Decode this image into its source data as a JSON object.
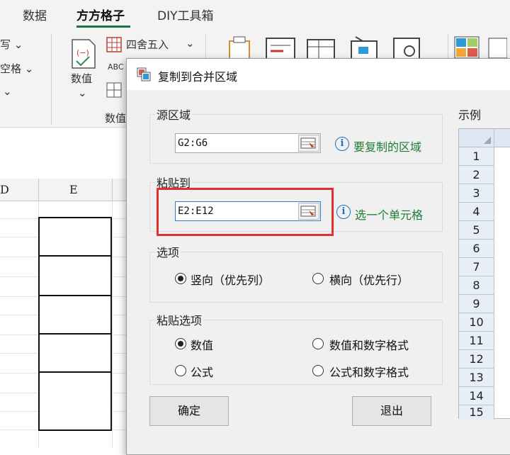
{
  "ribbon": {
    "tabs": [
      "数据",
      "方方格子",
      "DIY工具箱"
    ],
    "left_items": [
      "写",
      "空格",
      ""
    ],
    "numeric_label": "数值",
    "numeric_group_label": "数值",
    "round_label": "四舍五入",
    "abc_label": "ABC"
  },
  "sheet": {
    "col_d": "D",
    "col_e": "E"
  },
  "dialog": {
    "title": "复制到合并区域",
    "source": {
      "label": "源区域",
      "value": "G2:G6",
      "hint": "要复制的区域"
    },
    "paste_to": {
      "label": "粘贴到",
      "value": "E2:E12",
      "hint": "选一个单元格"
    },
    "options": {
      "label": "选项",
      "vertical": "竖向（优先列）",
      "horizontal": "横向（优先行）",
      "selected": "vertical"
    },
    "paste_options": {
      "label": "粘贴选项",
      "values": "数值",
      "values_and_format": "数值和数字格式",
      "formula": "公式",
      "formula_and_format": "公式和数字格式",
      "selected": "values"
    },
    "ok_label": "确定",
    "exit_label": "退出",
    "example": {
      "label": "示例",
      "rows": [
        "1",
        "2",
        "3",
        "4",
        "5",
        "6",
        "7",
        "8",
        "9",
        "10",
        "11",
        "12",
        "13",
        "14",
        "15"
      ]
    }
  },
  "colors": {
    "accent_green": "#1e7145",
    "hint_green": "#1f7d31",
    "highlight_red": "#e0312e",
    "info_blue": "#1b72c0"
  }
}
